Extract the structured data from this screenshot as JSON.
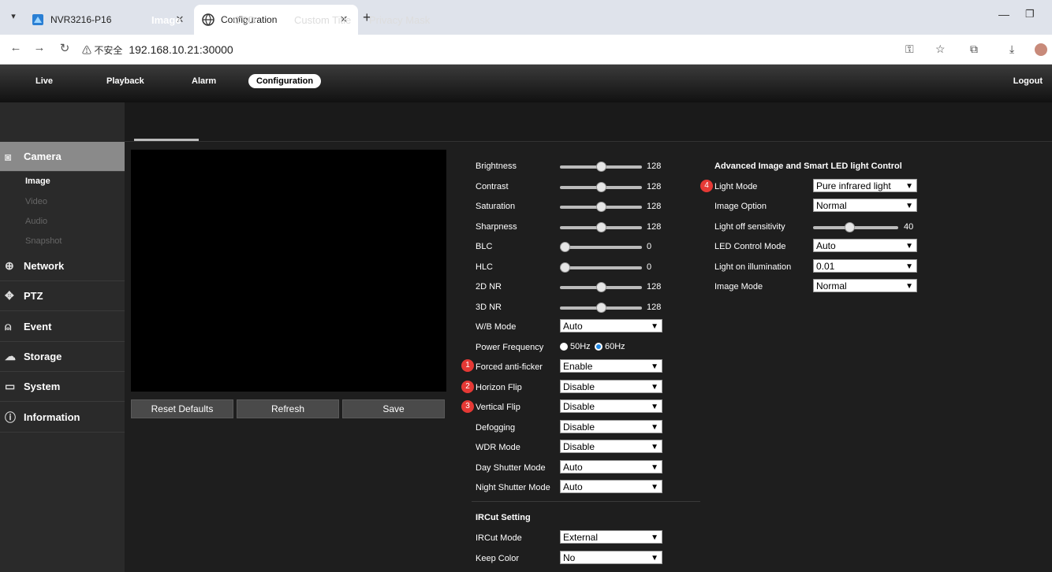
{
  "browser": {
    "tabs": [
      {
        "title": "NVR3216-P16",
        "active": false
      },
      {
        "title": "Configuration",
        "active": true
      }
    ],
    "new_tab": "+",
    "security_label": "不安全",
    "url": "192.168.10.21:30000"
  },
  "topnav": {
    "items": [
      "Live",
      "Playback",
      "Alarm",
      "Configuration"
    ],
    "active": "Configuration",
    "logout": "Logout"
  },
  "subtabs": {
    "items": [
      "Image",
      "OSD",
      "Custom Title",
      "Privacy Mask"
    ],
    "active": "Image"
  },
  "sidebar": {
    "camera": {
      "label": "Camera",
      "items": [
        "Image",
        "Video",
        "Audio",
        "Snapshot"
      ]
    },
    "network": "Network",
    "ptz": "PTZ",
    "event": "Event",
    "storage": "Storage",
    "system": "System",
    "information": "Information"
  },
  "buttons": {
    "reset": "Reset Defaults",
    "refresh": "Refresh",
    "save": "Save"
  },
  "image_settings": {
    "brightness": {
      "label": "Brightness",
      "value": "128"
    },
    "contrast": {
      "label": "Contrast",
      "value": "128"
    },
    "saturation": {
      "label": "Saturation",
      "value": "128"
    },
    "sharpness": {
      "label": "Sharpness",
      "value": "128"
    },
    "blc": {
      "label": "BLC",
      "value": "0"
    },
    "hlc": {
      "label": "HLC",
      "value": "0"
    },
    "nr2d": {
      "label": "2D NR",
      "value": "128"
    },
    "nr3d": {
      "label": "3D NR",
      "value": "128"
    },
    "wb_mode": {
      "label": "W/B Mode",
      "value": "Auto"
    },
    "power_frequency": {
      "label": "Power Frequency",
      "opt1": "50Hz",
      "opt2": "60Hz",
      "selected": "60Hz"
    },
    "anti_flicker": {
      "label": "Forced anti-ficker",
      "value": "Enable",
      "badge": "1"
    },
    "horizon_flip": {
      "label": "Horizon Flip",
      "value": "Disable",
      "badge": "2"
    },
    "vertical_flip": {
      "label": "Vertical Flip",
      "value": "Disable",
      "badge": "3"
    },
    "defogging": {
      "label": "Defogging",
      "value": "Disable"
    },
    "wdr_mode": {
      "label": "WDR Mode",
      "value": "Disable"
    },
    "day_shutter": {
      "label": "Day Shutter Mode",
      "value": "Auto"
    },
    "night_shutter": {
      "label": "Night Shutter Mode",
      "value": "Auto"
    }
  },
  "ircut": {
    "title": "IRCut Setting",
    "mode": {
      "label": "IRCut Mode",
      "value": "External"
    },
    "keep_color": {
      "label": "Keep Color",
      "value": "No"
    }
  },
  "advanced": {
    "title": "Advanced Image and Smart LED light Control",
    "light_mode": {
      "label": "Light Mode",
      "value": "Pure infrared light",
      "badge": "4"
    },
    "image_option": {
      "label": "Image Option",
      "value": "Normal"
    },
    "light_off_sensitivity": {
      "label": "Light off sensitivity",
      "value": "40"
    },
    "led_control_mode": {
      "label": "LED Control Mode",
      "value": "Auto"
    },
    "light_on_illumination": {
      "label": "Light on illumination",
      "value": "0.01"
    },
    "image_mode": {
      "label": "Image Mode",
      "value": "Normal"
    }
  }
}
